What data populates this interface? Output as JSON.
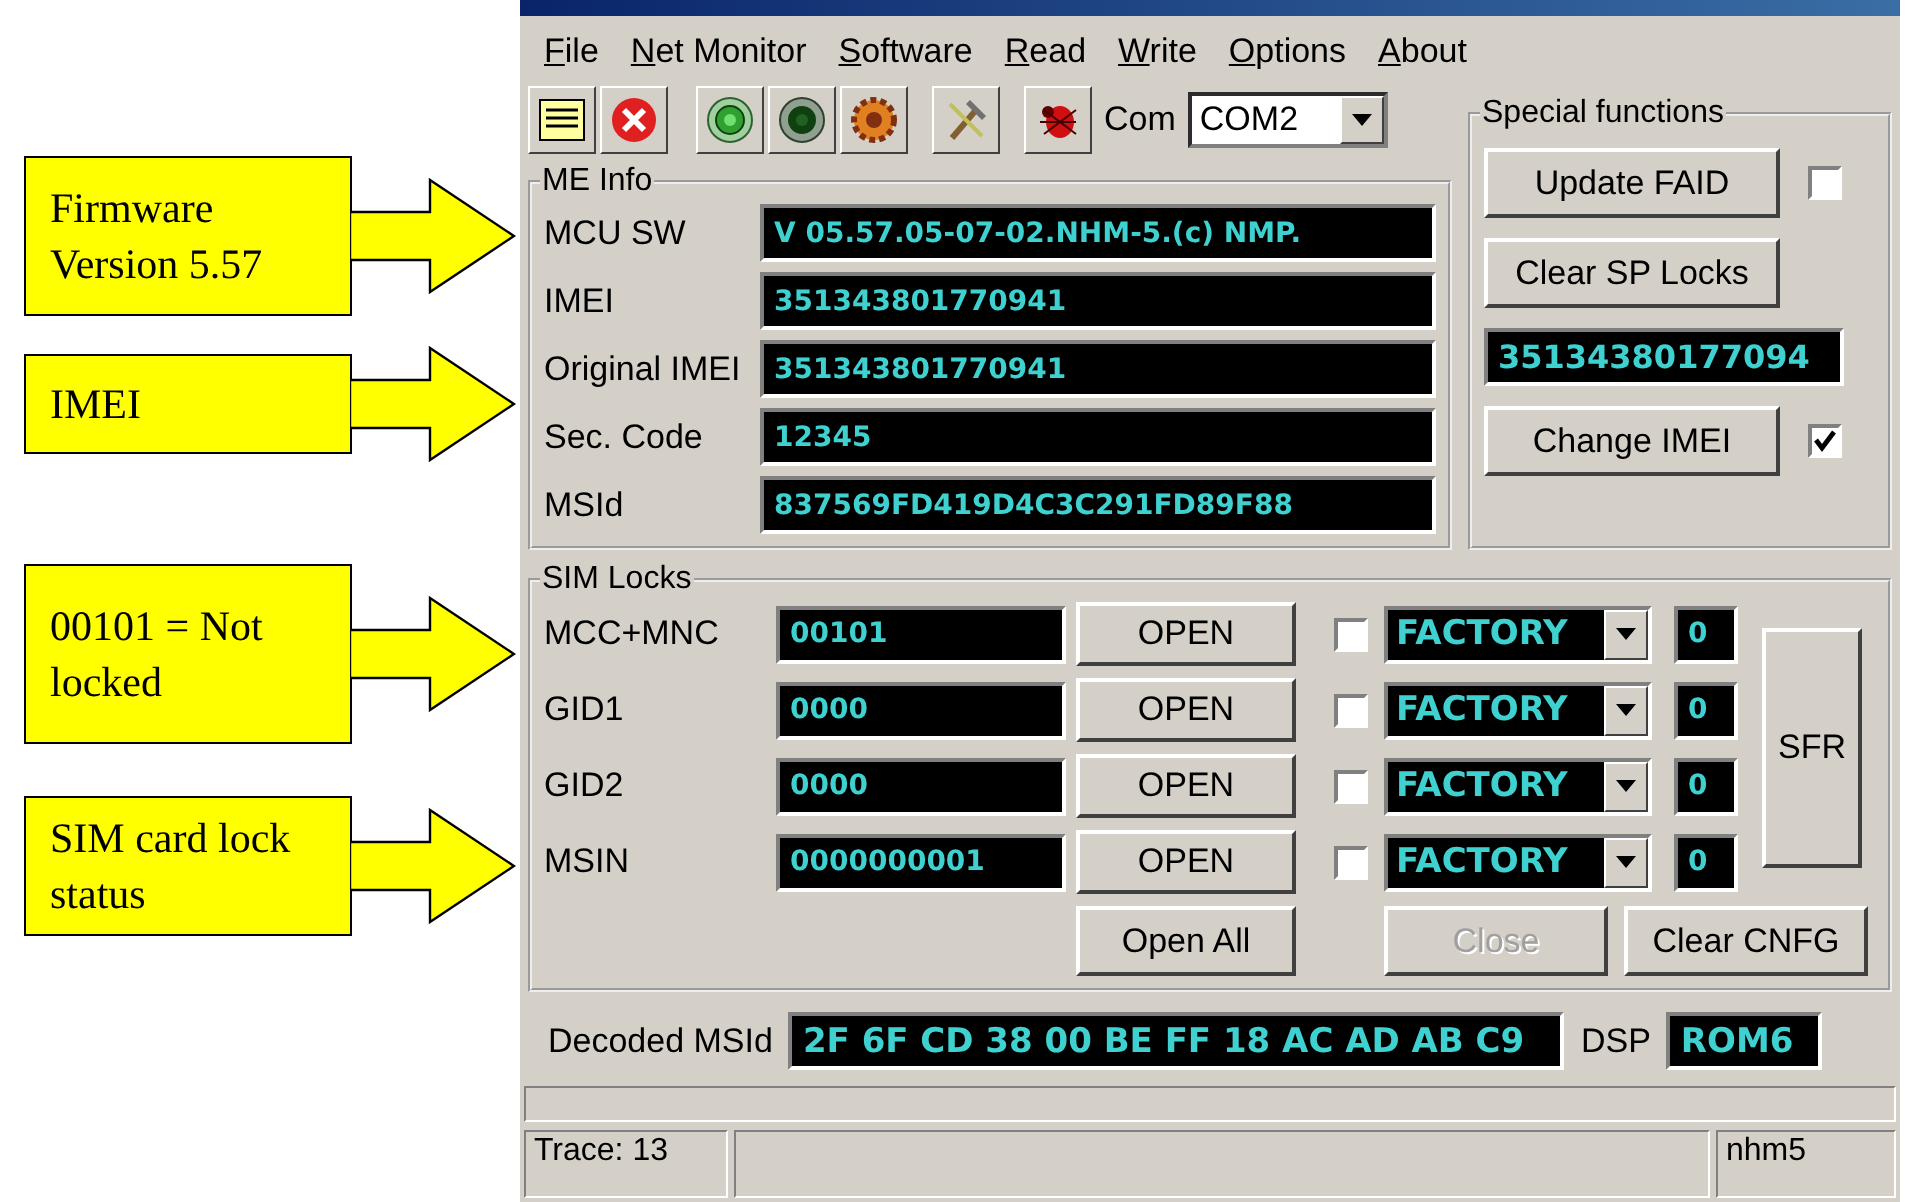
{
  "annotations": [
    {
      "text": "Firmware Version 5.57"
    },
    {
      "text": "IMEI"
    },
    {
      "text": "00101 = Not locked"
    },
    {
      "text": "SIM card lock status"
    }
  ],
  "menu": [
    "File",
    "Net Monitor",
    "Software",
    "Read",
    "Write",
    "Options",
    "About"
  ],
  "toolbar": {
    "com_label": "Com",
    "com_value": "COM2"
  },
  "me_info": {
    "title": "ME Info",
    "fields": [
      {
        "label": "MCU SW",
        "value": "V 05.57.05-07-02.NHM-5.(c) NMP."
      },
      {
        "label": "IMEI",
        "value": "351343801770941"
      },
      {
        "label": "Original IMEI",
        "value": "351343801770941"
      },
      {
        "label": "Sec. Code",
        "value": "12345"
      },
      {
        "label": "MSId",
        "value": "837569FD419D4C3C291FD89F88"
      }
    ]
  },
  "special_functions": {
    "title": "Special functions",
    "items": [
      {
        "kind": "button",
        "label": "Update FAID",
        "checked": false
      },
      {
        "kind": "button",
        "label": "Clear SP Locks"
      },
      {
        "kind": "display",
        "value": "35134380177094"
      },
      {
        "kind": "button",
        "label": "Change IMEI",
        "checked": true
      }
    ]
  },
  "sim_locks": {
    "title": "SIM Locks",
    "rows": [
      {
        "label": "MCC+MNC",
        "value": "00101",
        "button": "OPEN",
        "checked": false,
        "mode": "FACTORY",
        "count": "0"
      },
      {
        "label": "GID1",
        "value": "0000",
        "button": "OPEN",
        "checked": false,
        "mode": "FACTORY",
        "count": "0"
      },
      {
        "label": "GID2",
        "value": "0000",
        "button": "OPEN",
        "checked": false,
        "mode": "FACTORY",
        "count": "0"
      },
      {
        "label": "MSIN",
        "value": "0000000001",
        "button": "OPEN",
        "checked": false,
        "mode": "FACTORY",
        "count": "0"
      }
    ],
    "side_button": "SFR",
    "actions": [
      {
        "label": "Open All",
        "disabled": false
      },
      {
        "label": "Close",
        "disabled": true
      },
      {
        "label": "Clear CNFG",
        "disabled": false
      }
    ]
  },
  "decoded": {
    "label": "Decoded MSId",
    "value": "2F 6F CD 38 00 BE FF 18 AC AD AB C9",
    "dsp_label": "DSP",
    "dsp_value": "ROM6"
  },
  "status_bar": {
    "trace": "Trace: 13",
    "model": "nhm5"
  }
}
